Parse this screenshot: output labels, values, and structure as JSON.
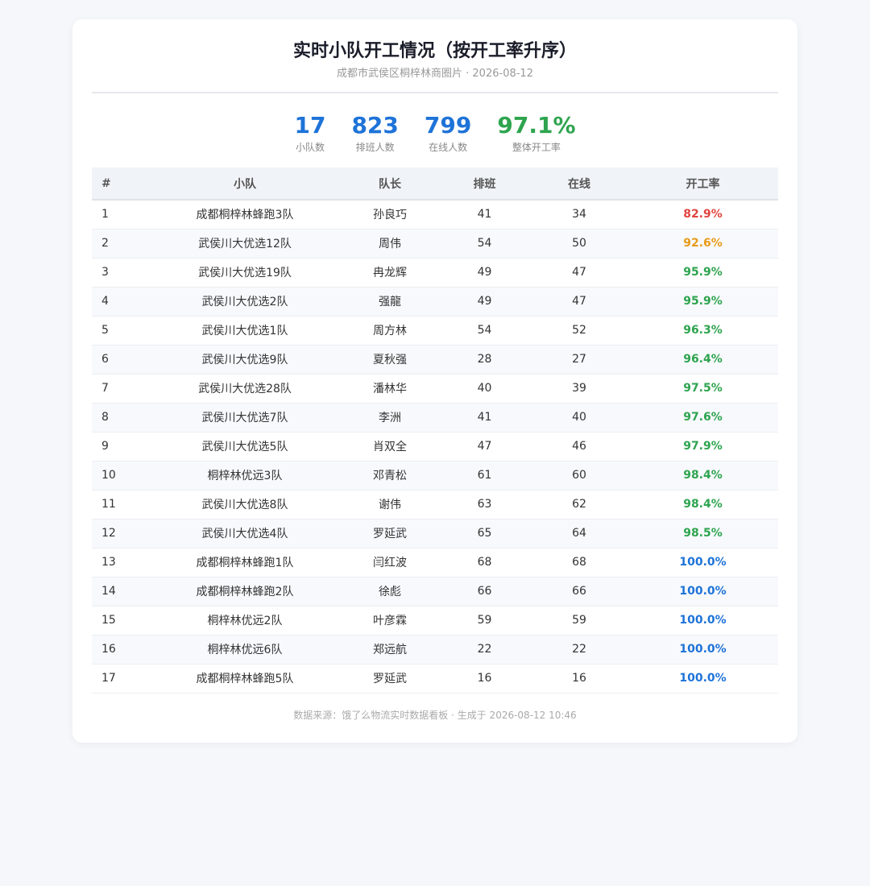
{
  "header": {
    "title": "实时小队开工情况（按开工率升序）",
    "subtitle": "成都市武侯区桐梓林商圈片 · 2026-08-12"
  },
  "stats": [
    {
      "value": "17",
      "label": "小队数",
      "color": "#1e73d8"
    },
    {
      "value": "823",
      "label": "排班人数",
      "color": "#1e73d8"
    },
    {
      "value": "799",
      "label": "在线人数",
      "color": "#1e73d8"
    },
    {
      "value": "97.1%",
      "label": "整体开工率",
      "color": "#2ea44f"
    }
  ],
  "table": {
    "columns": [
      "#",
      "小队",
      "队长",
      "排班",
      "在线",
      "开工率"
    ],
    "rows": [
      {
        "idx": "1",
        "team": "成都桐梓林蜂跑3队",
        "leader": "孙良巧",
        "scheduled": "41",
        "online": "34",
        "rate": "82.9%",
        "level": "red"
      },
      {
        "idx": "2",
        "team": "武侯川大优选12队",
        "leader": "周伟",
        "scheduled": "54",
        "online": "50",
        "rate": "92.6%",
        "level": "orange"
      },
      {
        "idx": "3",
        "team": "武侯川大优选19队",
        "leader": "冉龙辉",
        "scheduled": "49",
        "online": "47",
        "rate": "95.9%",
        "level": "green"
      },
      {
        "idx": "4",
        "team": "武侯川大优选2队",
        "leader": "强龍",
        "scheduled": "49",
        "online": "47",
        "rate": "95.9%",
        "level": "green"
      },
      {
        "idx": "5",
        "team": "武侯川大优选1队",
        "leader": "周方林",
        "scheduled": "54",
        "online": "52",
        "rate": "96.3%",
        "level": "green"
      },
      {
        "idx": "6",
        "team": "武侯川大优选9队",
        "leader": "夏秋强",
        "scheduled": "28",
        "online": "27",
        "rate": "96.4%",
        "level": "green"
      },
      {
        "idx": "7",
        "team": "武侯川大优选28队",
        "leader": "潘林华",
        "scheduled": "40",
        "online": "39",
        "rate": "97.5%",
        "level": "green"
      },
      {
        "idx": "8",
        "team": "武侯川大优选7队",
        "leader": "李洲",
        "scheduled": "41",
        "online": "40",
        "rate": "97.6%",
        "level": "green"
      },
      {
        "idx": "9",
        "team": "武侯川大优选5队",
        "leader": "肖双全",
        "scheduled": "47",
        "online": "46",
        "rate": "97.9%",
        "level": "green"
      },
      {
        "idx": "10",
        "team": "桐梓林优远3队",
        "leader": "邓青松",
        "scheduled": "61",
        "online": "60",
        "rate": "98.4%",
        "level": "green"
      },
      {
        "idx": "11",
        "team": "武侯川大优选8队",
        "leader": "谢伟",
        "scheduled": "63",
        "online": "62",
        "rate": "98.4%",
        "level": "green"
      },
      {
        "idx": "12",
        "team": "武侯川大优选4队",
        "leader": "罗延武",
        "scheduled": "65",
        "online": "64",
        "rate": "98.5%",
        "level": "green"
      },
      {
        "idx": "13",
        "team": "成都桐梓林蜂跑1队",
        "leader": "闫红波",
        "scheduled": "68",
        "online": "68",
        "rate": "100.0%",
        "level": "blue"
      },
      {
        "idx": "14",
        "team": "成都桐梓林蜂跑2队",
        "leader": "徐彪",
        "scheduled": "66",
        "online": "66",
        "rate": "100.0%",
        "level": "blue"
      },
      {
        "idx": "15",
        "team": "桐梓林优远2队",
        "leader": "叶彦霖",
        "scheduled": "59",
        "online": "59",
        "rate": "100.0%",
        "level": "blue"
      },
      {
        "idx": "16",
        "team": "桐梓林优远6队",
        "leader": "郑远航",
        "scheduled": "22",
        "online": "22",
        "rate": "100.0%",
        "level": "blue"
      },
      {
        "idx": "17",
        "team": "成都桐梓林蜂跑5队",
        "leader": "罗延武",
        "scheduled": "16",
        "online": "16",
        "rate": "100.0%",
        "level": "blue"
      }
    ]
  },
  "footer": {
    "text": "数据来源：饿了么物流实时数据看板 · 生成于 2026-08-12 10:46"
  },
  "colors": {
    "red": "#e0443e",
    "orange": "#e89a16",
    "green": "#2ea44f",
    "blue": "#1e73d8"
  }
}
